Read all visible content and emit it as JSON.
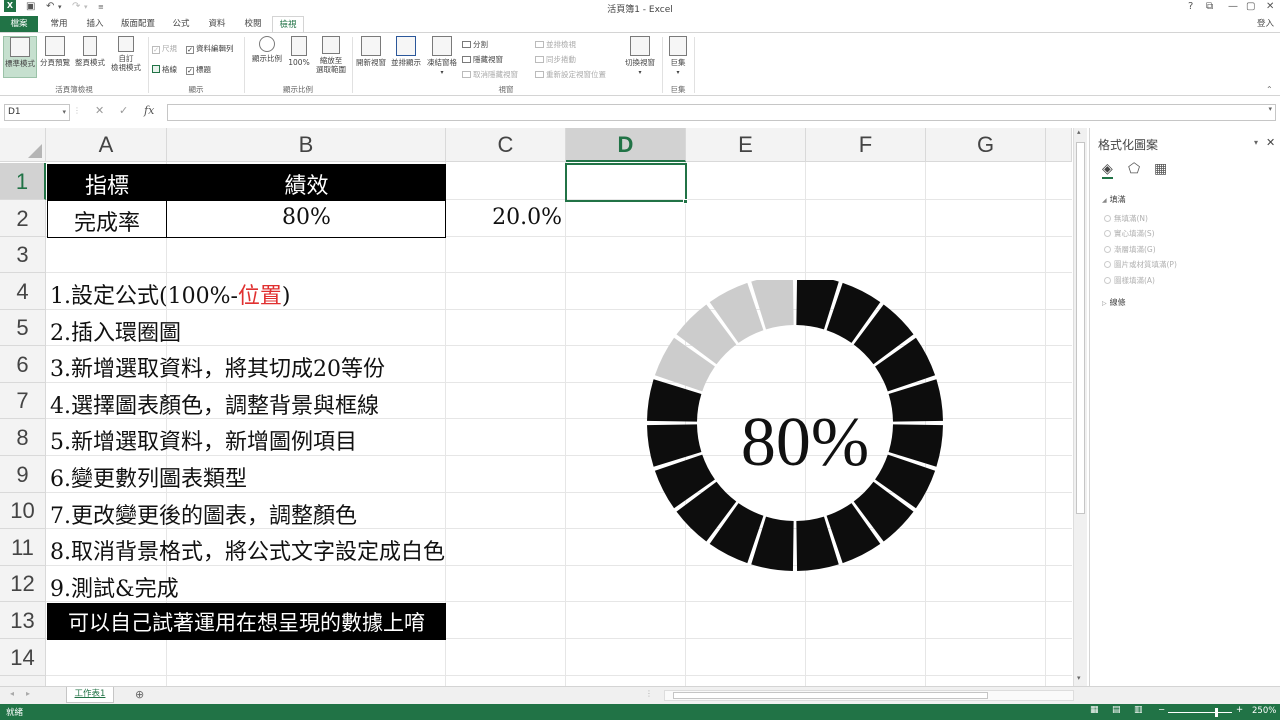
{
  "app": {
    "title": "活頁簿1 - Excel",
    "sign_in": "登入",
    "help": "?",
    "restore": "⧉",
    "minimize": "—",
    "maximize": "▢",
    "close": "✕"
  },
  "tabs": [
    "檔案",
    "常用",
    "插入",
    "版面配置",
    "公式",
    "資料",
    "校閱",
    "檢視"
  ],
  "ribbon": {
    "workbook_views": {
      "label": "活頁簿檢視",
      "normal": "標準模式",
      "page_break": "分頁預覽",
      "page_layout": "整頁模式",
      "custom_1": "自訂",
      "custom_2": "檢視模式"
    },
    "show": {
      "label": "顯示",
      "ruler": "尺規",
      "formula_bar": "資料編輯列",
      "gridlines": "格線",
      "headings": "標題"
    },
    "zoom": {
      "label": "顯示比例",
      "zoom": "顯示比例",
      "hundred": "100%",
      "fit_1": "縮放至",
      "fit_2": "選取範圍"
    },
    "window": {
      "label": "視窗",
      "new_window": "開新視窗",
      "arrange_all": "並排顯示",
      "freeze": "凍結窗格",
      "split": "分割",
      "hide": "隱藏視窗",
      "unhide": "取消隱藏視窗",
      "side_by_side": "並排檢視",
      "sync_scroll": "同步捲動",
      "reset_pos": "重新設定視窗位置",
      "switch": "切換視窗"
    },
    "macros": {
      "label": "巨集",
      "macros": "巨集"
    }
  },
  "formula_bar": {
    "name_box": "D1",
    "fx": "fx",
    "cancel": "✕",
    "enter": "✓"
  },
  "grid": {
    "columns": [
      "A",
      "B",
      "C",
      "D",
      "E",
      "F",
      "G"
    ],
    "rows": [
      "1",
      "2",
      "3",
      "4",
      "5",
      "6",
      "7",
      "8",
      "9",
      "10",
      "11",
      "12",
      "13",
      "14"
    ],
    "header_cells": {
      "a1": "指標",
      "b1": "績效"
    },
    "data_cells": {
      "a2": "完成率",
      "b2": "80%",
      "c2": "20.0%"
    },
    "steps": {
      "s1a": "1.設定公式(100%-",
      "s1b": "位置",
      "s1c": ")",
      "s2": "2.插入環圈圖",
      "s3": "3.新增選取資料，將其切成20等份",
      "s4": "4.選擇圖表顏色，調整背景與框線",
      "s5": "5.新增選取資料，新增圖例項目",
      "s6": "6.變更數列圖表類型",
      "s7": "7.更改變更後的圖表，調整顏色",
      "s8": "8.取消背景格式，將公式文字設定成白色",
      "s9": "9.測試&完成",
      "s13": "可以自己試著運用在想呈現的數據上唷"
    },
    "accent_red": "#e03030"
  },
  "chart_data": {
    "type": "pie",
    "subtype": "doughnut",
    "center_label": "80%",
    "segments": 20,
    "filled_fraction": 0.8,
    "values": [
      80,
      20
    ],
    "colors": {
      "filled": "#0d0d0d",
      "remaining": "#cccccc"
    }
  },
  "pane": {
    "title": "格式化圖案",
    "fill_section": "填滿",
    "options": [
      "無填滿(N)",
      "實心填滿(S)",
      "漸層填滿(G)",
      "圖片或材質填滿(P)",
      "圖樣填滿(A)"
    ],
    "line_section": "線條"
  },
  "sheet": {
    "tab": "工作表1",
    "add": "⊕"
  },
  "status": {
    "ready": "就緒",
    "zoom": "250%",
    "minus": "−",
    "plus": "+"
  }
}
